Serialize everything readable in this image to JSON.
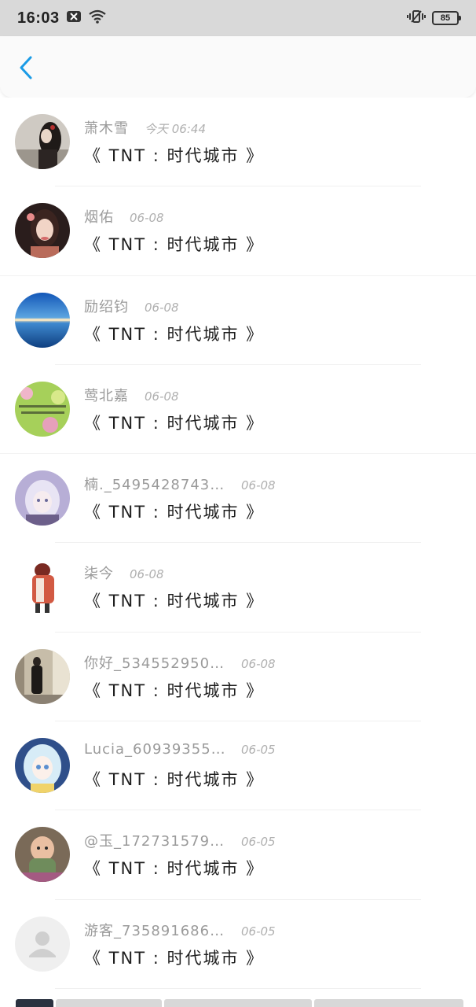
{
  "status_bar": {
    "time": "16:03",
    "battery": "85",
    "icons": [
      "notification-icon",
      "wifi-icon",
      "vibrate-icon",
      "battery-icon"
    ]
  },
  "header": {
    "back_icon": "chevron-left-icon",
    "accent_color": "#1a9be6"
  },
  "items": [
    {
      "name": "萧木雪",
      "date": "今天 06:44",
      "title": "《 TNT : 时代城市 》"
    },
    {
      "name": "烟佑",
      "date": "06-08",
      "title": "《 TNT : 时代城市 》"
    },
    {
      "name": "励绍钧",
      "date": "06-08",
      "title": "《 TNT : 时代城市 》"
    },
    {
      "name": "莺北嘉",
      "date": "06-08",
      "title": "《 TNT : 时代城市 》"
    },
    {
      "name": "楠._54954287433 ...",
      "date": "06-08",
      "title": "《 TNT : 时代城市 》"
    },
    {
      "name": "柒今",
      "date": "06-08",
      "title": "《 TNT : 时代城市 》"
    },
    {
      "name": "你好_5345529509 ...",
      "date": "06-08",
      "title": "《 TNT : 时代城市 》"
    },
    {
      "name": "Lucia_60939355880 ...",
      "date": "06-05",
      "title": "《 TNT : 时代城市 》"
    },
    {
      "name": "@玉_17273157990 ...",
      "date": "06-05",
      "title": "《 TNT : 时代城市 》"
    },
    {
      "name": "游客_7358916869 ...",
      "date": "06-05",
      "title": "《 TNT : 时代城市 》"
    }
  ]
}
